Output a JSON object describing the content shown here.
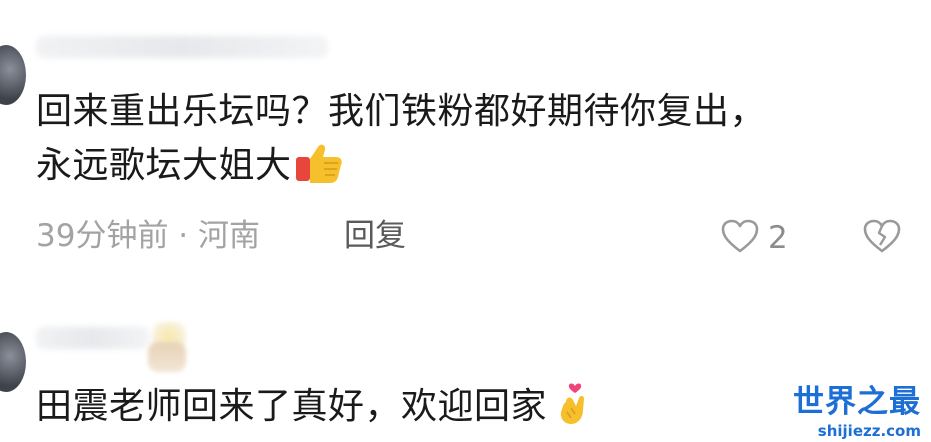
{
  "comments": [
    {
      "line1": "回来重出乐坛吗？我们铁粉都好期待你复出，",
      "line2": "永远歌坛大姐大",
      "emoji": "thumbs-up",
      "time_location": "39分钟前 · 河南",
      "reply_label": "回复",
      "like_count": "2"
    },
    {
      "line1": "田震老师回来了真好，欢迎回家",
      "emoji": "finger-heart"
    }
  ],
  "watermark": {
    "title": "世界之最",
    "url": "shijiezz.com"
  },
  "colors": {
    "text": "#1a1a1a",
    "meta": "#a3a3a3",
    "watermark": "#1d6fd6"
  }
}
